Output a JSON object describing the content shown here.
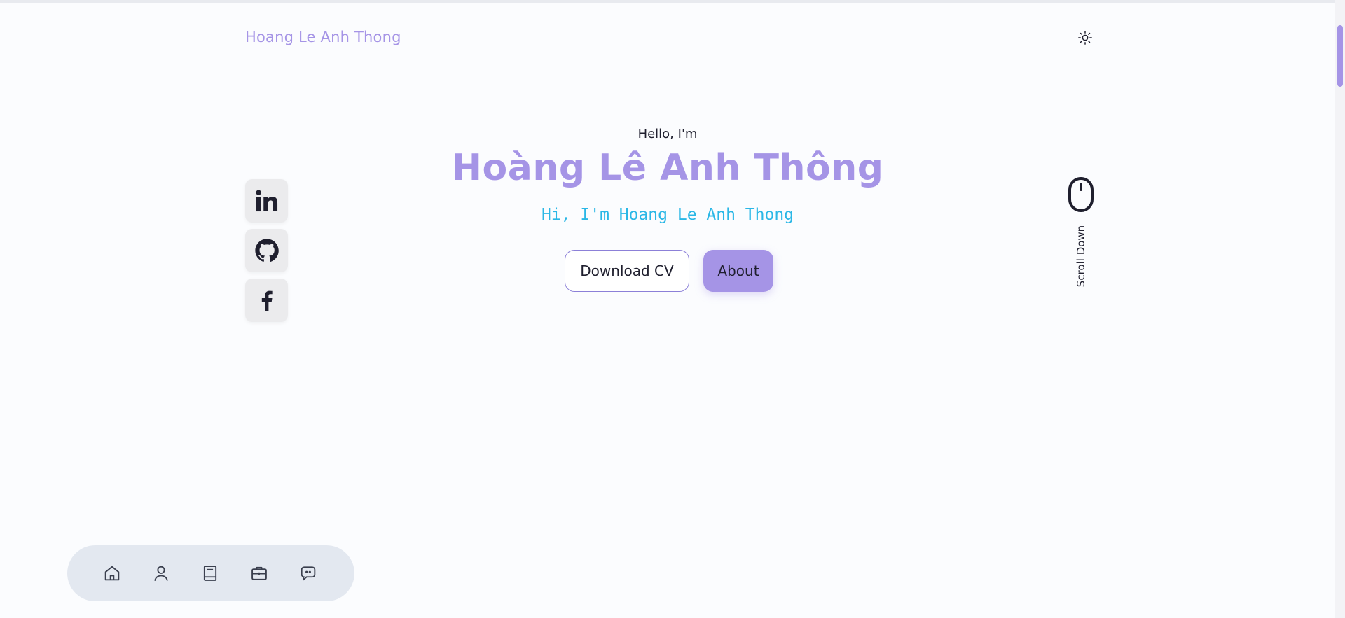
{
  "header": {
    "brand": "Hoang Le Anh Thong",
    "theme_icon": "sun-icon"
  },
  "hero": {
    "greeting": "Hello, I'm",
    "name": "Hoàng Lê Anh Thông",
    "typed_text": "Hi, I'm Hoang Le Anh Thong",
    "download_cv_label": "Download CV",
    "about_label": "About"
  },
  "social": [
    "linkedin-icon",
    "github-icon",
    "facebook-icon"
  ],
  "scroll": {
    "label": "Scroll Down",
    "icon": "mouse-icon"
  },
  "dock": [
    "home-icon",
    "user-icon",
    "book-icon",
    "briefcase-icon",
    "message-icon"
  ],
  "colors": {
    "accent": "#a594e6",
    "typed": "#2ab7e6",
    "dock_bg": "#e3e8f0",
    "social_bg": "#ebebed"
  }
}
